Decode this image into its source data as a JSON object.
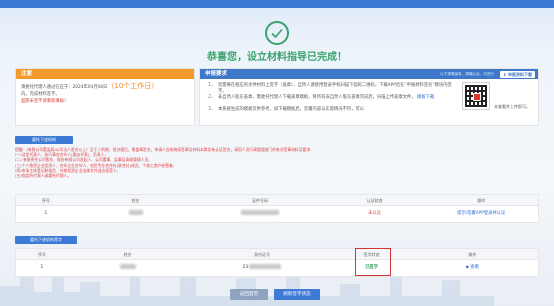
{
  "success_title": "恭喜您，设立材料指导已完成！",
  "notice": {
    "header": "注意",
    "line1_prefix": "请委托代理人通过在应于：2024年04月08日",
    "deadline_highlight": "（10个工作日）",
    "line2": "内，完成材料签字。",
    "line3": "超期未签字请重新填报！"
  },
  "apply": {
    "header": "申报要求",
    "header_tip": "以下请确保有，请确认后，可进行",
    "download_btn": "申报资料下载",
    "steps": [
      {
        "n": "1、",
        "text": "您需要在相应的文件材料上签字（盖章），自然人请使用登录手机扫描下面的二维码，下载APP后在“申报材料签名”模块内签字。"
      },
      {
        "n": "2、",
        "text": "非自然人股东盖章，需委托代理人下载盖章模板，将所有非自然人股东盖章完成后，扫描上传盖章文件。",
        "link": "模板下载"
      },
      {
        "n": "3、",
        "text": "本系统生成的模板仅供参考，如下载模板后，签署内容与实际情况不符，可以"
      }
    ],
    "qr_after": "本查看并上传即可。"
  },
  "btn_upload_stamp": "委托下述机构",
  "warning_lines": [
    "提醒：(有限公司董监高/公司法人签名以上）至于二的期，但办理后，需盖章签名，申请人应知晓如签章及材料本属实有认证签名，请用人员行政管理部门的有关签章材料及要求:",
    "(一)法定代表人、执行事务合伙人(委派代表)、负责人;",
    "(二) 有限责任公司股东、股份有限公司发起人、公司董事、监事及高级管理人员;",
    "(三)个人独资企业投资人、合伙企业合伙人、农民专业合作社(联合社)成员、个体工商户经营者;",
    "(四)市场主体登记联络员、外商投资企业法律文件送达接受人;",
    "(五)指定的代表人或委托代理人。"
  ],
  "table1": {
    "columns": [
      "序号",
      "姓名",
      "证件号码",
      "认证状态",
      "操作"
    ],
    "rows": [
      {
        "no": "1",
        "status": "未认证",
        "action": "提示/签署APP登录并认证"
      }
    ]
  },
  "btn_upload_sign": "委托下述机构签字",
  "table2": {
    "columns": [
      "序号",
      "姓名",
      "身份证号",
      "签字状态",
      "操作"
    ],
    "rows": [
      {
        "no": "1",
        "id_prefix": "23",
        "status": "已签字",
        "action": "查看"
      }
    ]
  },
  "footer": {
    "back": "返回首页",
    "refresh": "刷新签字状态"
  },
  "colors": {
    "accent_blue": "#3d7ad6",
    "success_green": "#39a36d",
    "notice_orange": "#f39a2d",
    "error_red": "#e04040"
  }
}
